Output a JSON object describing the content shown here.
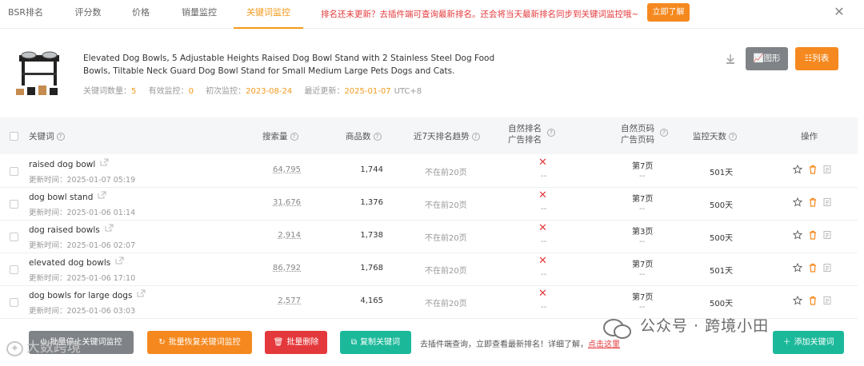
{
  "tabs": [
    {
      "label": "BSR排名",
      "active": false
    },
    {
      "label": "评分数",
      "active": false
    },
    {
      "label": "价格",
      "active": false
    },
    {
      "label": "销量监控",
      "active": false
    },
    {
      "label": "关键词监控",
      "active": true
    }
  ],
  "notice": {
    "text": "排名还未更新？去插件端可查询最新排名。还会将当天最新排名同步到关键词监控哦~",
    "button": "立即了解"
  },
  "product": {
    "title": "Elevated Dog Bowls, 5 Adjustable Heights Raised Dog Bowl Stand with 2 Stainless Steel Dog Food Bowls, Tiltable Neck Guard Dog Bowl Stand for Small Medium Large Pets Dogs and Cats.",
    "meta": {
      "kw_count_label": "关键词数量：",
      "kw_count": "5",
      "valid_label": "有效监控：",
      "valid": "0",
      "first_label": "初次监控：",
      "first": "2023-08-24",
      "last_label": "最近更新：",
      "last": "2025-01-07",
      "tz": "UTC+8"
    }
  },
  "view_buttons": {
    "chart": "图形",
    "list": "列表"
  },
  "table": {
    "headers": {
      "keyword": "关键词",
      "search_volume": "搜索量",
      "product_count": "商品数",
      "trend": "近7天排名趋势",
      "natural_rank_1": "自然排名",
      "natural_rank_2": "广告排名",
      "natural_page_1": "自然页码",
      "natural_page_2": "广告页码",
      "days": "监控天数",
      "action": "操作"
    },
    "rows": [
      {
        "keyword": "raised dog bowl",
        "updated": "更新时间：2025-01-07 05:19",
        "search_volume": "64,795",
        "products": "1,744",
        "trend": "不在前20页",
        "ad_rank": "--",
        "page": "第7页",
        "ad_page": "--",
        "days": "501天"
      },
      {
        "keyword": "dog bowl stand",
        "updated": "更新时间：2025-01-06 01:14",
        "search_volume": "31,676",
        "products": "1,376",
        "trend": "不在前20页",
        "ad_rank": "--",
        "page": "第7页",
        "ad_page": "--",
        "days": "500天"
      },
      {
        "keyword": "dog raised bowls",
        "updated": "更新时间：2025-01-06 02:07",
        "search_volume": "2,914",
        "products": "1,738",
        "trend": "不在前20页",
        "ad_rank": "--",
        "page": "第3页",
        "ad_page": "--",
        "days": "500天"
      },
      {
        "keyword": "elevated dog bowls",
        "updated": "更新时间：2025-01-06 17:10",
        "search_volume": "86,792",
        "products": "1,768",
        "trend": "不在前20页",
        "ad_rank": "--",
        "page": "第7页",
        "ad_page": "--",
        "days": "501天"
      },
      {
        "keyword": "dog bowls for large dogs",
        "updated": "更新时间：2025-01-06 03:03",
        "search_volume": "2,577",
        "products": "4,165",
        "trend": "不在前20页",
        "ad_rank": "--",
        "page": "第7页",
        "ad_page": "--",
        "days": "500天"
      }
    ]
  },
  "bottom": {
    "stop": "批量停止关键词监控",
    "restore": "批量恢复关键词监控",
    "delete": "批量删除",
    "copy": "复制关键词",
    "hint": "去插件端查询，立即查看最新排名！详细了解，",
    "hint_link": "点击这里",
    "add": "添加关键词"
  },
  "watermarks": {
    "wechat": "公众号 · 跨境小田",
    "left": "大数跨境"
  },
  "colors": {
    "accent": "#f5891f",
    "danger": "#e4393c",
    "teal": "#1bb99a",
    "gray": "#7f8387"
  }
}
